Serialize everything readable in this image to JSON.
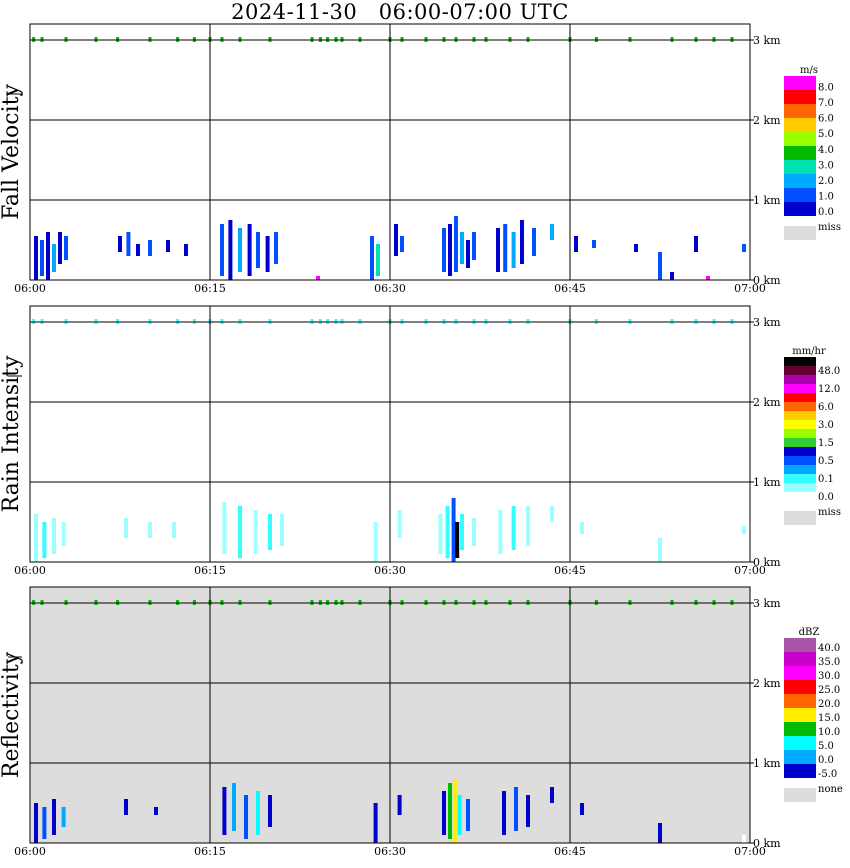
{
  "title": "2024-11-30   06:00-07:00 UTC",
  "chart_data": [
    {
      "type": "heatmap",
      "ylabel": "Fall Velocity",
      "x_ticks": [
        "06:00",
        "06:15",
        "06:30",
        "06:45",
        "07:00"
      ],
      "y_ticks": [
        "0 km",
        "1 km",
        "2 km",
        "3 km"
      ],
      "ylim": [
        0,
        3.2
      ],
      "background": "none",
      "legend": {
        "unit": "m/s",
        "labels": [
          "8.0",
          "7.0",
          "6.0",
          "5.0",
          "4.0",
          "3.0",
          "2.0",
          "1.0",
          "0.0"
        ],
        "colors": [
          "#ff00ff",
          "#ff0000",
          "#ff6600",
          "#ffcc00",
          "#99ff00",
          "#00bb00",
          "#00e0b0",
          "#00aaff",
          "#0050ff",
          "#0000cc"
        ],
        "miss_label": "miss"
      },
      "cells": [
        {
          "t": 0.5,
          "h0": 0.0,
          "h1": 0.55,
          "c": "#0000cc"
        },
        {
          "t": 1.0,
          "h0": 0.05,
          "h1": 0.5,
          "c": "#0050ff"
        },
        {
          "t": 1.5,
          "h0": 0.0,
          "h1": 0.6,
          "c": "#0000cc"
        },
        {
          "t": 2.0,
          "h0": 0.1,
          "h1": 0.45,
          "c": "#00aaff"
        },
        {
          "t": 2.5,
          "h0": 0.2,
          "h1": 0.6,
          "c": "#0000cc"
        },
        {
          "t": 3.0,
          "h0": 0.25,
          "h1": 0.55,
          "c": "#0050ff"
        },
        {
          "t": 7.5,
          "h0": 0.35,
          "h1": 0.55,
          "c": "#0000cc"
        },
        {
          "t": 8.2,
          "h0": 0.3,
          "h1": 0.6,
          "c": "#0050ff"
        },
        {
          "t": 9.0,
          "h0": 0.3,
          "h1": 0.45,
          "c": "#0000cc"
        },
        {
          "t": 10.0,
          "h0": 0.3,
          "h1": 0.5,
          "c": "#0050ff"
        },
        {
          "t": 11.5,
          "h0": 0.35,
          "h1": 0.5,
          "c": "#0000cc"
        },
        {
          "t": 13.0,
          "h0": 0.3,
          "h1": 0.45,
          "c": "#0000cc"
        },
        {
          "t": 16.0,
          "h0": 0.05,
          "h1": 0.7,
          "c": "#0050ff"
        },
        {
          "t": 16.7,
          "h0": 0.0,
          "h1": 0.75,
          "c": "#0000cc"
        },
        {
          "t": 17.5,
          "h0": 0.1,
          "h1": 0.65,
          "c": "#00aaff"
        },
        {
          "t": 18.3,
          "h0": 0.05,
          "h1": 0.7,
          "c": "#0000cc"
        },
        {
          "t": 19.0,
          "h0": 0.15,
          "h1": 0.6,
          "c": "#0050ff"
        },
        {
          "t": 19.8,
          "h0": 0.1,
          "h1": 0.55,
          "c": "#0000cc"
        },
        {
          "t": 20.5,
          "h0": 0.2,
          "h1": 0.6,
          "c": "#0050ff"
        },
        {
          "t": 24.0,
          "h0": 0.0,
          "h1": 0.05,
          "c": "#ff00ff"
        },
        {
          "t": 28.5,
          "h0": 0.0,
          "h1": 0.55,
          "c": "#0050ff"
        },
        {
          "t": 29.0,
          "h0": 0.05,
          "h1": 0.45,
          "c": "#00e0b0"
        },
        {
          "t": 30.5,
          "h0": 0.3,
          "h1": 0.7,
          "c": "#0000cc"
        },
        {
          "t": 31.0,
          "h0": 0.35,
          "h1": 0.55,
          "c": "#0050ff"
        },
        {
          "t": 34.5,
          "h0": 0.1,
          "h1": 0.65,
          "c": "#0050ff"
        },
        {
          "t": 35.0,
          "h0": 0.05,
          "h1": 0.7,
          "c": "#0000cc"
        },
        {
          "t": 35.5,
          "h0": 0.1,
          "h1": 0.8,
          "c": "#0050ff"
        },
        {
          "t": 36.0,
          "h0": 0.2,
          "h1": 0.6,
          "c": "#00aaff"
        },
        {
          "t": 36.5,
          "h0": 0.15,
          "h1": 0.5,
          "c": "#0000cc"
        },
        {
          "t": 37.0,
          "h0": 0.25,
          "h1": 0.6,
          "c": "#0050ff"
        },
        {
          "t": 39.0,
          "h0": 0.1,
          "h1": 0.65,
          "c": "#0000cc"
        },
        {
          "t": 39.6,
          "h0": 0.1,
          "h1": 0.7,
          "c": "#0050ff"
        },
        {
          "t": 40.3,
          "h0": 0.15,
          "h1": 0.6,
          "c": "#00aaff"
        },
        {
          "t": 41.0,
          "h0": 0.2,
          "h1": 0.75,
          "c": "#0000cc"
        },
        {
          "t": 42.0,
          "h0": 0.3,
          "h1": 0.65,
          "c": "#0050ff"
        },
        {
          "t": 43.5,
          "h0": 0.5,
          "h1": 0.7,
          "c": "#00aaff"
        },
        {
          "t": 45.5,
          "h0": 0.35,
          "h1": 0.55,
          "c": "#0000cc"
        },
        {
          "t": 47.0,
          "h0": 0.4,
          "h1": 0.5,
          "c": "#0050ff"
        },
        {
          "t": 50.5,
          "h0": 0.35,
          "h1": 0.45,
          "c": "#0000cc"
        },
        {
          "t": 52.5,
          "h0": 0.0,
          "h1": 0.35,
          "c": "#0050ff"
        },
        {
          "t": 53.5,
          "h0": 0.0,
          "h1": 0.1,
          "c": "#0000cc"
        },
        {
          "t": 55.5,
          "h0": 0.35,
          "h1": 0.55,
          "c": "#0000cc"
        },
        {
          "t": 56.5,
          "h0": 0.0,
          "h1": 0.05,
          "c": "#ff00ff"
        },
        {
          "t": 59.5,
          "h0": 0.35,
          "h1": 0.45,
          "c": "#0050ff"
        }
      ],
      "top_band": {
        "h": 3.0,
        "c": "#00bb00",
        "t": [
          0.3,
          1.0,
          3.0,
          5.5,
          7.3,
          10.0,
          12.3,
          13.7,
          15.0,
          16.0,
          17.5,
          20.0,
          23.5,
          24.2,
          24.8,
          25.5,
          26.0,
          27.5,
          30.0,
          31.0,
          33.0,
          34.5,
          35.5,
          37.0,
          38.0,
          40.0,
          41.5,
          45.0,
          47.2,
          50.0,
          53.5,
          55.5,
          57.0,
          58.5
        ]
      }
    },
    {
      "type": "heatmap",
      "ylabel": "Rain Intensity",
      "x_ticks": [
        "06:00",
        "06:15",
        "06:30",
        "06:45",
        "07:00"
      ],
      "y_ticks": [
        "0 km",
        "1 km",
        "2 km",
        "3 km"
      ],
      "ylim": [
        0,
        3.2
      ],
      "background": "none",
      "legend": {
        "unit": "mm/hr",
        "labels": [
          "48.0",
          "12.0",
          "6.0",
          "3.0",
          "1.5",
          "0.5",
          "0.1",
          "0.0"
        ],
        "colors": [
          "#000000",
          "#660033",
          "#aa00aa",
          "#ff00ff",
          "#ff0000",
          "#ff6600",
          "#ffcc00",
          "#ffff00",
          "#99ff00",
          "#33cc33",
          "#0000cc",
          "#0050ff",
          "#00aaff",
          "#33ffff",
          "#99ffff",
          "#ffffff"
        ],
        "miss_label": "miss"
      },
      "cells": [
        {
          "t": 0.5,
          "h0": 0.0,
          "h1": 0.6,
          "c": "#99ffff"
        },
        {
          "t": 1.2,
          "h0": 0.05,
          "h1": 0.5,
          "c": "#33ffff"
        },
        {
          "t": 2.0,
          "h0": 0.1,
          "h1": 0.55,
          "c": "#99ffff"
        },
        {
          "t": 2.8,
          "h0": 0.2,
          "h1": 0.5,
          "c": "#99ffff"
        },
        {
          "t": 8.0,
          "h0": 0.3,
          "h1": 0.55,
          "c": "#99ffff"
        },
        {
          "t": 10.0,
          "h0": 0.3,
          "h1": 0.5,
          "c": "#99ffff"
        },
        {
          "t": 12.0,
          "h0": 0.3,
          "h1": 0.5,
          "c": "#99ffff"
        },
        {
          "t": 16.2,
          "h0": 0.1,
          "h1": 0.75,
          "c": "#99ffff"
        },
        {
          "t": 17.5,
          "h0": 0.05,
          "h1": 0.7,
          "c": "#33ffff"
        },
        {
          "t": 18.8,
          "h0": 0.1,
          "h1": 0.65,
          "c": "#99ffff"
        },
        {
          "t": 20.0,
          "h0": 0.15,
          "h1": 0.6,
          "c": "#33ffff"
        },
        {
          "t": 21.0,
          "h0": 0.2,
          "h1": 0.6,
          "c": "#99ffff"
        },
        {
          "t": 28.8,
          "h0": 0.0,
          "h1": 0.5,
          "c": "#99ffff"
        },
        {
          "t": 30.8,
          "h0": 0.3,
          "h1": 0.65,
          "c": "#99ffff"
        },
        {
          "t": 34.2,
          "h0": 0.1,
          "h1": 0.6,
          "c": "#99ffff"
        },
        {
          "t": 34.8,
          "h0": 0.05,
          "h1": 0.7,
          "c": "#33ffff"
        },
        {
          "t": 35.3,
          "h0": 0.0,
          "h1": 0.8,
          "c": "#0050ff"
        },
        {
          "t": 35.6,
          "h0": 0.05,
          "h1": 0.5,
          "c": "#000000"
        },
        {
          "t": 36.0,
          "h0": 0.15,
          "h1": 0.6,
          "c": "#33ffff"
        },
        {
          "t": 37.0,
          "h0": 0.2,
          "h1": 0.55,
          "c": "#99ffff"
        },
        {
          "t": 39.2,
          "h0": 0.1,
          "h1": 0.65,
          "c": "#99ffff"
        },
        {
          "t": 40.3,
          "h0": 0.15,
          "h1": 0.7,
          "c": "#33ffff"
        },
        {
          "t": 41.5,
          "h0": 0.2,
          "h1": 0.7,
          "c": "#99ffff"
        },
        {
          "t": 43.5,
          "h0": 0.5,
          "h1": 0.7,
          "c": "#99ffff"
        },
        {
          "t": 46.0,
          "h0": 0.35,
          "h1": 0.5,
          "c": "#99ffff"
        },
        {
          "t": 52.5,
          "h0": 0.0,
          "h1": 0.3,
          "c": "#99ffff"
        },
        {
          "t": 59.5,
          "h0": 0.35,
          "h1": 0.45,
          "c": "#99ffff"
        }
      ],
      "top_band": {
        "h": 3.0,
        "c": "#33ffff",
        "t": [
          0.3,
          1.0,
          3.0,
          5.5,
          7.3,
          10.0,
          12.3,
          13.7,
          15.0,
          16.0,
          17.5,
          20.0,
          23.5,
          24.2,
          24.8,
          25.5,
          26.0,
          27.5,
          30.0,
          31.0,
          33.0,
          34.5,
          35.5,
          37.0,
          38.0,
          40.0,
          41.5,
          45.0,
          47.2,
          50.0,
          53.5,
          55.5,
          57.0,
          58.5
        ]
      }
    },
    {
      "type": "heatmap",
      "ylabel": "Reflectivity",
      "x_ticks": [
        "06:00",
        "06:15",
        "06:30",
        "06:45",
        "07:00"
      ],
      "y_ticks": [
        "0 km",
        "1 km",
        "2 km",
        "3 km"
      ],
      "ylim": [
        0,
        3.2
      ],
      "background": "#dddddd",
      "legend": {
        "unit": "dBZ",
        "labels": [
          "40.0",
          "35.0",
          "30.0",
          "25.0",
          "20.0",
          "15.0",
          "10.0",
          "5.0",
          "0.0",
          "-5.0"
        ],
        "colors": [
          "#aa55aa",
          "#cc00cc",
          "#ff00ff",
          "#ff0000",
          "#ff6600",
          "#ffee00",
          "#00bb00",
          "#00ffff",
          "#00aaff",
          "#0000cc"
        ],
        "miss_label": "none"
      },
      "cells": [
        {
          "t": 0.5,
          "h0": 0.0,
          "h1": 0.5,
          "c": "#0000cc"
        },
        {
          "t": 1.2,
          "h0": 0.05,
          "h1": 0.45,
          "c": "#0050ff"
        },
        {
          "t": 2.0,
          "h0": 0.1,
          "h1": 0.55,
          "c": "#0000cc"
        },
        {
          "t": 2.8,
          "h0": 0.2,
          "h1": 0.45,
          "c": "#00aaff"
        },
        {
          "t": 8.0,
          "h0": 0.35,
          "h1": 0.55,
          "c": "#0000cc"
        },
        {
          "t": 10.5,
          "h0": 0.35,
          "h1": 0.45,
          "c": "#0000cc"
        },
        {
          "t": 16.2,
          "h0": 0.1,
          "h1": 0.7,
          "c": "#0000cc"
        },
        {
          "t": 17.0,
          "h0": 0.15,
          "h1": 0.75,
          "c": "#00aaff"
        },
        {
          "t": 18.0,
          "h0": 0.05,
          "h1": 0.6,
          "c": "#0050ff"
        },
        {
          "t": 19.0,
          "h0": 0.1,
          "h1": 0.65,
          "c": "#00ffff"
        },
        {
          "t": 20.0,
          "h0": 0.2,
          "h1": 0.6,
          "c": "#0000cc"
        },
        {
          "t": 28.8,
          "h0": 0.0,
          "h1": 0.5,
          "c": "#0000cc"
        },
        {
          "t": 30.8,
          "h0": 0.35,
          "h1": 0.6,
          "c": "#0000cc"
        },
        {
          "t": 34.5,
          "h0": 0.1,
          "h1": 0.65,
          "c": "#0000cc"
        },
        {
          "t": 35.0,
          "h0": 0.05,
          "h1": 0.75,
          "c": "#00bb00"
        },
        {
          "t": 35.4,
          "h0": 0.0,
          "h1": 0.8,
          "c": "#ffee00"
        },
        {
          "t": 35.8,
          "h0": 0.1,
          "h1": 0.6,
          "c": "#00ffff"
        },
        {
          "t": 36.5,
          "h0": 0.15,
          "h1": 0.55,
          "c": "#0050ff"
        },
        {
          "t": 39.5,
          "h0": 0.1,
          "h1": 0.65,
          "c": "#0000cc"
        },
        {
          "t": 40.5,
          "h0": 0.15,
          "h1": 0.7,
          "c": "#0050ff"
        },
        {
          "t": 41.5,
          "h0": 0.2,
          "h1": 0.6,
          "c": "#0000cc"
        },
        {
          "t": 43.5,
          "h0": 0.5,
          "h1": 0.7,
          "c": "#0000cc"
        },
        {
          "t": 46.0,
          "h0": 0.35,
          "h1": 0.5,
          "c": "#0000cc"
        },
        {
          "t": 52.5,
          "h0": 0.0,
          "h1": 0.25,
          "c": "#0000cc"
        },
        {
          "t": 59.5,
          "h0": 0.0,
          "h1": 0.1,
          "c": "#ffffff"
        }
      ],
      "top_band": {
        "h": 3.0,
        "c": "#00bb00",
        "t": [
          0.3,
          1.0,
          3.0,
          5.5,
          7.3,
          10.0,
          12.3,
          13.7,
          15.0,
          16.0,
          17.5,
          20.0,
          23.5,
          24.2,
          24.8,
          25.5,
          26.0,
          27.5,
          30.0,
          31.0,
          33.0,
          34.5,
          35.5,
          37.0,
          38.0,
          40.0,
          41.5,
          45.0,
          47.2,
          50.0,
          53.5,
          55.5,
          57.0,
          58.5
        ]
      }
    }
  ]
}
